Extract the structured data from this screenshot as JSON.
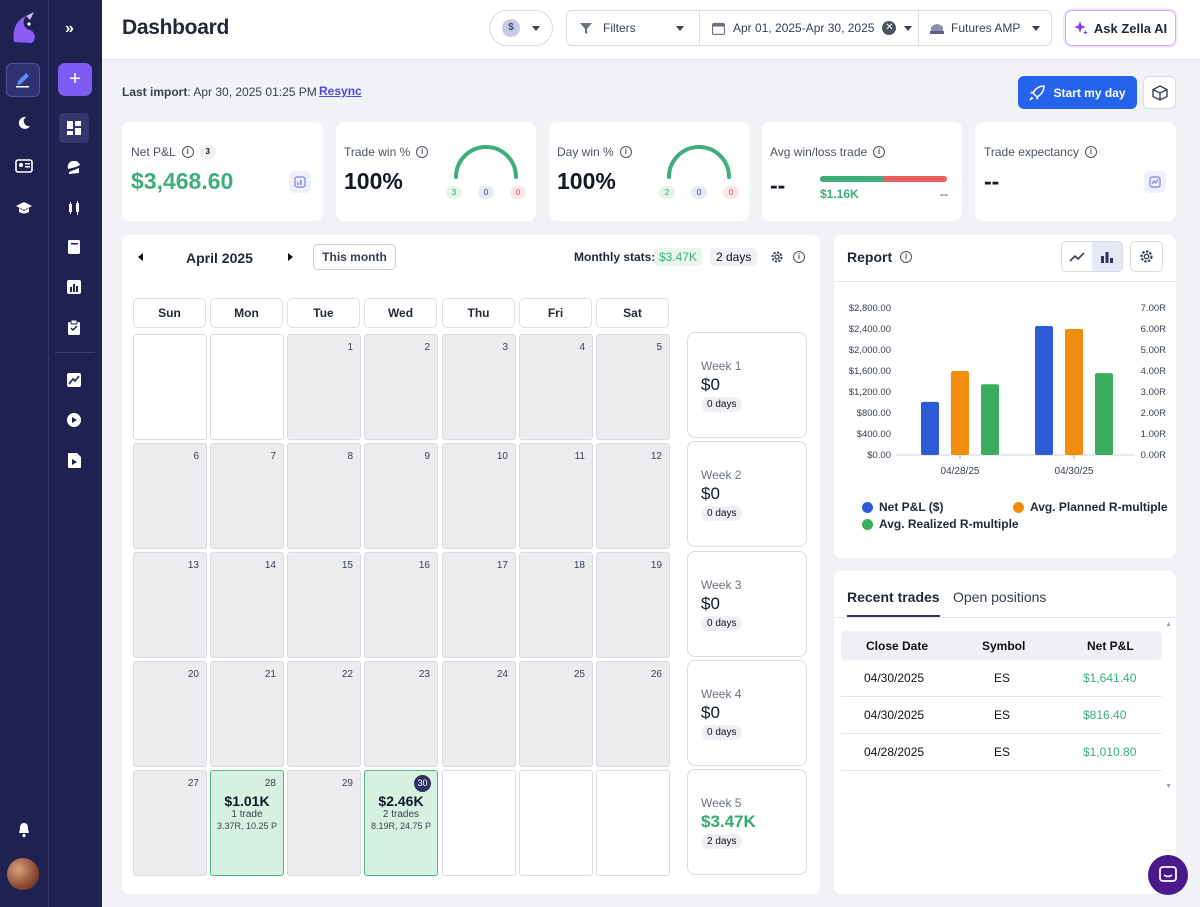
{
  "header": {
    "title": "Dashboard",
    "account_symbol": "$",
    "filters_label": "Filters",
    "date_range": "Apr 01, 2025-Apr 30, 2025",
    "account_name": "Futures AMP",
    "ask_ai_label": "Ask Zella AI"
  },
  "import_bar": {
    "label": "Last import",
    "value": ": Apr 30, 2025 01:25 PM",
    "resync_label": "Resync",
    "start_day_label": "Start my day"
  },
  "stats": {
    "net_pnl": {
      "label": "Net P&L",
      "count": "3",
      "value": "$3,468.60"
    },
    "trade_win": {
      "label": "Trade win %",
      "value": "100%",
      "wins": "3",
      "breakeven": "0",
      "losses": "0",
      "win_fraction": 1.0
    },
    "day_win": {
      "label": "Day win %",
      "value": "100%",
      "wins": "2",
      "breakeven": "0",
      "losses": "0",
      "win_fraction": 1.0
    },
    "avg_win_loss": {
      "label": "Avg win/loss trade",
      "value": "--",
      "avg_win": "$1.16K",
      "avg_loss": "--"
    },
    "expectancy": {
      "label": "Trade expectancy",
      "value": "--"
    }
  },
  "calendar": {
    "month_label": "April 2025",
    "this_month_label": "This month",
    "monthly_stats_label": "Monthly stats:",
    "monthly_pnl": "$3.47K",
    "monthly_days": "2 days",
    "weekdays": [
      "Sun",
      "Mon",
      "Tue",
      "Wed",
      "Thu",
      "Fri",
      "Sat"
    ],
    "day_28": {
      "pnl": "$1.01K",
      "trades": "1 trade",
      "detail": "3.37R, 10.25 P"
    },
    "day_30": {
      "pnl": "$2.46K",
      "trades": "2 trades",
      "detail": "8.19R, 24.75 P"
    },
    "weeks": [
      {
        "label": "Week 1",
        "value": "$0",
        "days": "0 days"
      },
      {
        "label": "Week 2",
        "value": "$0",
        "days": "0 days"
      },
      {
        "label": "Week 3",
        "value": "$0",
        "days": "0 days"
      },
      {
        "label": "Week 4",
        "value": "$0",
        "days": "0 days"
      },
      {
        "label": "Week 5",
        "value": "$3.47K",
        "days": "2 days"
      }
    ]
  },
  "report": {
    "title": "Report"
  },
  "chart_data": {
    "type": "bar",
    "categories": [
      "04/28/25",
      "04/30/25"
    ],
    "left_ticks": [
      "$0.00",
      "$400.00",
      "$800.00",
      "$1,200.00",
      "$1,600.00",
      "$2,000.00",
      "$2,400.00",
      "$2,800.00"
    ],
    "right_ticks": [
      "0.00R",
      "1.00R",
      "2.00R",
      "3.00R",
      "4.00R",
      "5.00R",
      "6.00R",
      "7.00R"
    ],
    "ylim_left": [
      0,
      2800
    ],
    "ylim_right": [
      0,
      7
    ],
    "series": [
      {
        "name": "Net P&L ($)",
        "axis": "left",
        "color": "#2f5bd6",
        "values": [
          1010.8,
          2457.8
        ]
      },
      {
        "name": "Avg. Planned R-multiple",
        "axis": "right",
        "color": "#f28c0c",
        "values": [
          4.0,
          6.0
        ]
      },
      {
        "name": "Avg. Realized R-multiple",
        "axis": "right",
        "color": "#3aae5c",
        "values": [
          3.37,
          3.9
        ]
      }
    ],
    "grid": false
  },
  "trades": {
    "tab_recent": "Recent trades",
    "tab_open": "Open positions",
    "headers": [
      "Close Date",
      "Symbol",
      "Net P&L"
    ],
    "rows": [
      [
        "04/30/2025",
        "ES",
        "$1,641.40"
      ],
      [
        "04/30/2025",
        "ES",
        "$816.40"
      ],
      [
        "04/28/2025",
        "ES",
        "$1,010.80"
      ]
    ]
  },
  "colors": {
    "sidebar": "#1f2150",
    "accent": "#2563eb",
    "positive": "#2fae6b",
    "loss": "#e85d5d"
  }
}
